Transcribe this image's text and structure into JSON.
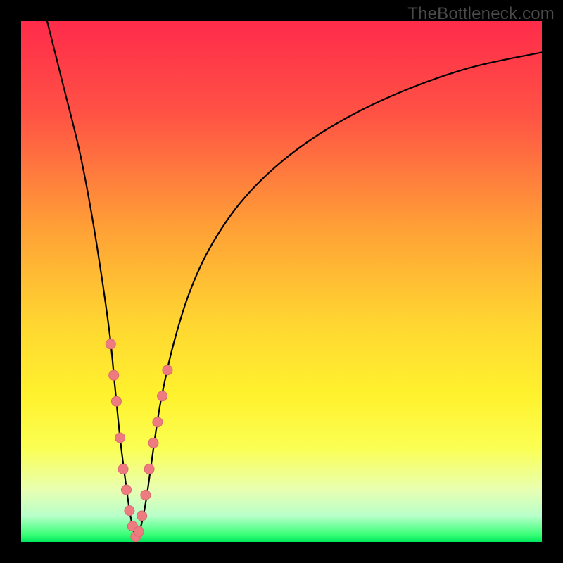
{
  "watermark": "TheBottleneck.com",
  "colors": {
    "frame": "#000000",
    "curve": "#000000",
    "marker_fill": "#ee7b80",
    "marker_stroke": "#d86a70",
    "gradient_stops": [
      {
        "offset": 0.0,
        "color": "#ff2b4a"
      },
      {
        "offset": 0.18,
        "color": "#ff5345"
      },
      {
        "offset": 0.4,
        "color": "#ffa136"
      },
      {
        "offset": 0.58,
        "color": "#ffd631"
      },
      {
        "offset": 0.72,
        "color": "#fff22e"
      },
      {
        "offset": 0.82,
        "color": "#fbff53"
      },
      {
        "offset": 0.9,
        "color": "#e8ffb2"
      },
      {
        "offset": 0.95,
        "color": "#b8ffca"
      },
      {
        "offset": 0.985,
        "color": "#3eff79"
      },
      {
        "offset": 1.0,
        "color": "#00e85e"
      }
    ]
  },
  "chart_data": {
    "type": "line",
    "title": "",
    "xlabel": "",
    "ylabel": "",
    "xlim": [
      0,
      100
    ],
    "ylim": [
      0,
      100
    ],
    "optimum_x": 22,
    "series": [
      {
        "name": "bottleneck-curve",
        "x": [
          5,
          8,
          11,
          13,
          15,
          17,
          18,
          19,
          20,
          21,
          22,
          23,
          24,
          25,
          26,
          27,
          29,
          32,
          36,
          42,
          50,
          60,
          72,
          86,
          100
        ],
        "y": [
          100,
          88,
          76,
          66,
          54,
          40,
          30,
          20,
          12,
          5,
          1,
          3,
          8,
          15,
          22,
          28,
          37,
          47,
          56,
          65,
          73,
          80,
          86,
          91,
          94
        ]
      }
    ],
    "markers": {
      "name": "highlighted-points",
      "x": [
        17.2,
        17.8,
        18.3,
        19.0,
        19.6,
        20.2,
        20.8,
        21.4,
        22.0,
        22.6,
        23.2,
        23.9,
        24.6,
        25.4,
        26.2,
        27.1,
        28.1
      ],
      "y": [
        38,
        32,
        27,
        20,
        14,
        10,
        6,
        3,
        1,
        2,
        5,
        9,
        14,
        19,
        23,
        28,
        33
      ],
      "r": 7
    }
  }
}
